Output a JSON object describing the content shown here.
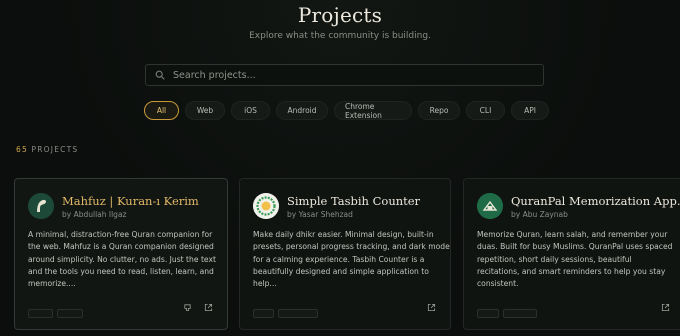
{
  "header": {
    "title": "Projects",
    "subtitle": "Explore what the community is building."
  },
  "search": {
    "placeholder": "Search projects..."
  },
  "filters": [
    {
      "label": "All",
      "active": true
    },
    {
      "label": "Web",
      "active": false
    },
    {
      "label": "iOS",
      "active": false
    },
    {
      "label": "Android",
      "active": false
    },
    {
      "label": "Chrome Extension",
      "active": false
    },
    {
      "label": "Repo",
      "active": false
    },
    {
      "label": "CLI",
      "active": false
    },
    {
      "label": "API",
      "active": false
    }
  ],
  "results": {
    "count": "65",
    "label": "PROJECTS"
  },
  "cards": [
    {
      "title": "Mahfuz | Kuran-ı Kerim",
      "author": "by Abdullah Ilgaz",
      "description": "A minimal, distraction-free Quran companion for the web. Mahfuz is a Quran companion designed around simplicity. No clutter, no ads. Just the text and the tools you need to read, listen, learn, and memorize....",
      "actions": [
        "github-icon",
        "external-link-icon"
      ]
    },
    {
      "title": "Simple Tasbih Counter",
      "author": "by Yasar Shehzad",
      "description": "Make daily dhikr easier. Minimal design, built-in presets, personal progress tracking, and dark mode for a calming experience. Tasbih Counter is a beautifully designed and simple application to help...",
      "actions": [
        "external-link-icon"
      ]
    },
    {
      "title": "QuranPal Memorization App...",
      "author": "by Abu Zaynab",
      "description": "Memorize Quran, learn salah, and remember your duas. Built for busy Muslims. QuranPal uses spaced repetition, short daily sessions, beautiful recitations, and smart reminders to help you stay consistent.",
      "actions": [
        "external-link-icon"
      ]
    }
  ],
  "colors": {
    "background": "#0b0e0c",
    "accent": "#d1a447",
    "card": "#101411",
    "text": "#ece8dd"
  }
}
